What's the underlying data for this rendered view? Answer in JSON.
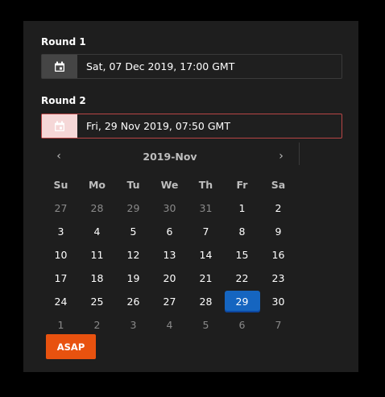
{
  "round1": {
    "label": "Round 1",
    "value": "Sat, 07 Dec 2019, 17:00 GMT"
  },
  "round2": {
    "label": "Round 2",
    "value": "Fri, 29 Nov 2019, 07:50 GMT"
  },
  "calendar": {
    "title": "2019-Nov",
    "prev": "‹",
    "next": "›",
    "weekdays": [
      "Su",
      "Mo",
      "Tu",
      "We",
      "Th",
      "Fr",
      "Sa"
    ],
    "weeks": [
      [
        {
          "d": "27",
          "m": true
        },
        {
          "d": "28",
          "m": true
        },
        {
          "d": "29",
          "m": true
        },
        {
          "d": "30",
          "m": true
        },
        {
          "d": "31",
          "m": true
        },
        {
          "d": "1"
        },
        {
          "d": "2"
        }
      ],
      [
        {
          "d": "3"
        },
        {
          "d": "4"
        },
        {
          "d": "5"
        },
        {
          "d": "6"
        },
        {
          "d": "7"
        },
        {
          "d": "8"
        },
        {
          "d": "9"
        }
      ],
      [
        {
          "d": "10"
        },
        {
          "d": "11"
        },
        {
          "d": "12"
        },
        {
          "d": "13"
        },
        {
          "d": "14"
        },
        {
          "d": "15"
        },
        {
          "d": "16"
        }
      ],
      [
        {
          "d": "17"
        },
        {
          "d": "18"
        },
        {
          "d": "19"
        },
        {
          "d": "20"
        },
        {
          "d": "21"
        },
        {
          "d": "22"
        },
        {
          "d": "23"
        }
      ],
      [
        {
          "d": "24"
        },
        {
          "d": "25"
        },
        {
          "d": "26"
        },
        {
          "d": "27"
        },
        {
          "d": "28"
        },
        {
          "d": "29",
          "sel": true
        },
        {
          "d": "30"
        }
      ],
      [
        {
          "d": "1",
          "m": true
        },
        {
          "d": "2",
          "m": true
        },
        {
          "d": "3",
          "m": true
        },
        {
          "d": "4",
          "m": true
        },
        {
          "d": "5",
          "m": true
        },
        {
          "d": "6",
          "m": true
        },
        {
          "d": "7",
          "m": true
        }
      ]
    ]
  },
  "asap_label": "ASAP",
  "colors": {
    "accent_selected": "#1565c0",
    "asap": "#e8520f",
    "active_border": "#b84646"
  }
}
